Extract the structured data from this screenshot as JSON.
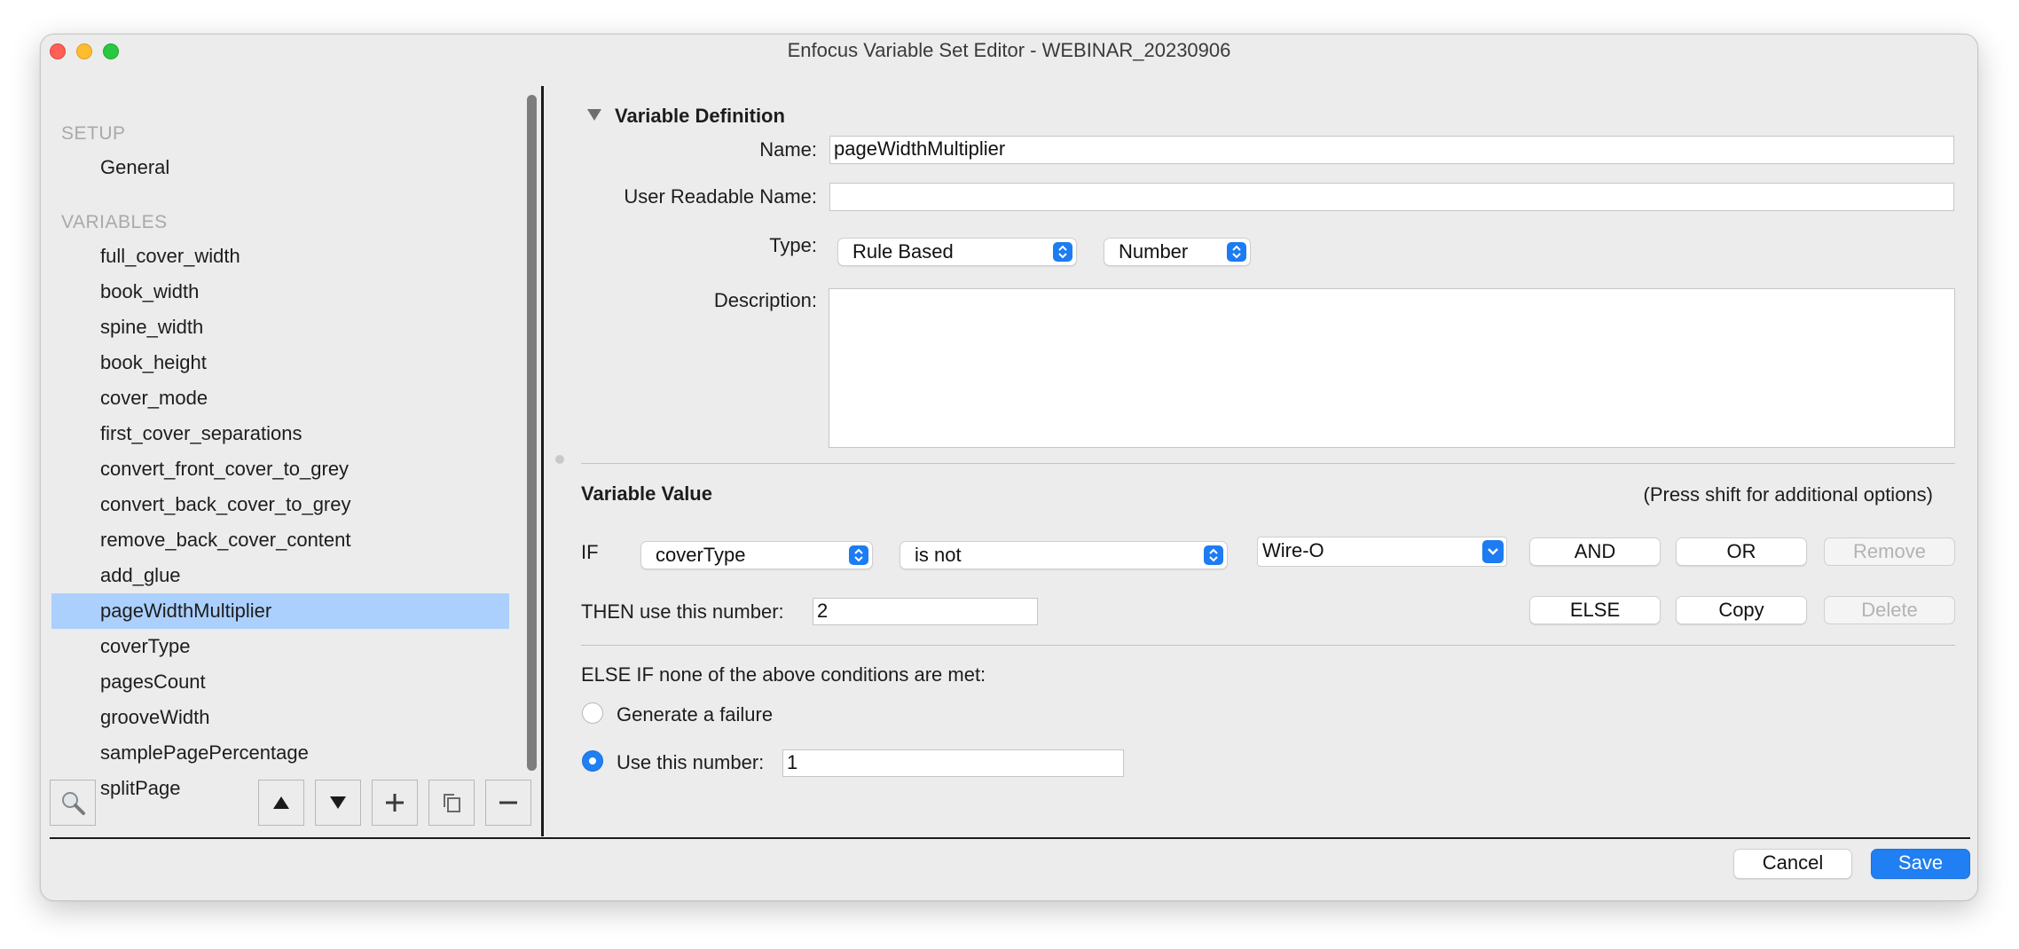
{
  "window": {
    "title": "Enfocus Variable Set Editor - WEBINAR_20230906"
  },
  "sidebar": {
    "setup_header": "SETUP",
    "setup_items": [
      {
        "label": "General"
      }
    ],
    "variables_header": "VARIABLES",
    "variables": [
      {
        "label": "full_cover_width"
      },
      {
        "label": "book_width"
      },
      {
        "label": "spine_width"
      },
      {
        "label": "book_height"
      },
      {
        "label": "cover_mode"
      },
      {
        "label": "first_cover_separations"
      },
      {
        "label": "convert_front_cover_to_grey"
      },
      {
        "label": "convert_back_cover_to_grey"
      },
      {
        "label": "remove_back_cover_content"
      },
      {
        "label": "add_glue"
      },
      {
        "label": "pageWidthMultiplier",
        "selected": true
      },
      {
        "label": "coverType"
      },
      {
        "label": "pagesCount"
      },
      {
        "label": "grooveWidth"
      },
      {
        "label": "samplePagePercentage"
      },
      {
        "label": "splitPage"
      }
    ],
    "toolbar": [
      "search-icon",
      "move-up-icon",
      "move-down-icon",
      "add-icon",
      "duplicate-icon",
      "remove-icon"
    ]
  },
  "definition": {
    "section_title": "Variable Definition",
    "name_label": "Name:",
    "name_value": "pageWidthMultiplier",
    "readable_label": "User Readable Name:",
    "readable_value": "",
    "type_label": "Type:",
    "type_value": "Rule Based",
    "subtype_value": "Number",
    "description_label": "Description:",
    "description_value": ""
  },
  "value": {
    "section_title": "Variable Value",
    "hint": "(Press shift for additional options)",
    "if_label": "IF",
    "condition_variable": "coverType",
    "condition_operator": "is not",
    "condition_value": "Wire-O",
    "and_label": "AND",
    "or_label": "OR",
    "remove_label": "Remove",
    "then_label": "THEN use this number:",
    "then_value": "2",
    "else_label": "ELSE",
    "copy_label": "Copy",
    "delete_label": "Delete",
    "else_if_label": "ELSE IF none of the above conditions are met:",
    "failure_label": "Generate a failure",
    "use_number_label": "Use this number:",
    "use_number_value": "1",
    "selected_option": "use_number"
  },
  "footer": {
    "cancel_label": "Cancel",
    "save_label": "Save"
  },
  "colors": {
    "accent": "#1f7ff3",
    "selection": "#acd0fd",
    "close": "#fe5f57",
    "minimize": "#febc2e",
    "maximize": "#28c840"
  }
}
